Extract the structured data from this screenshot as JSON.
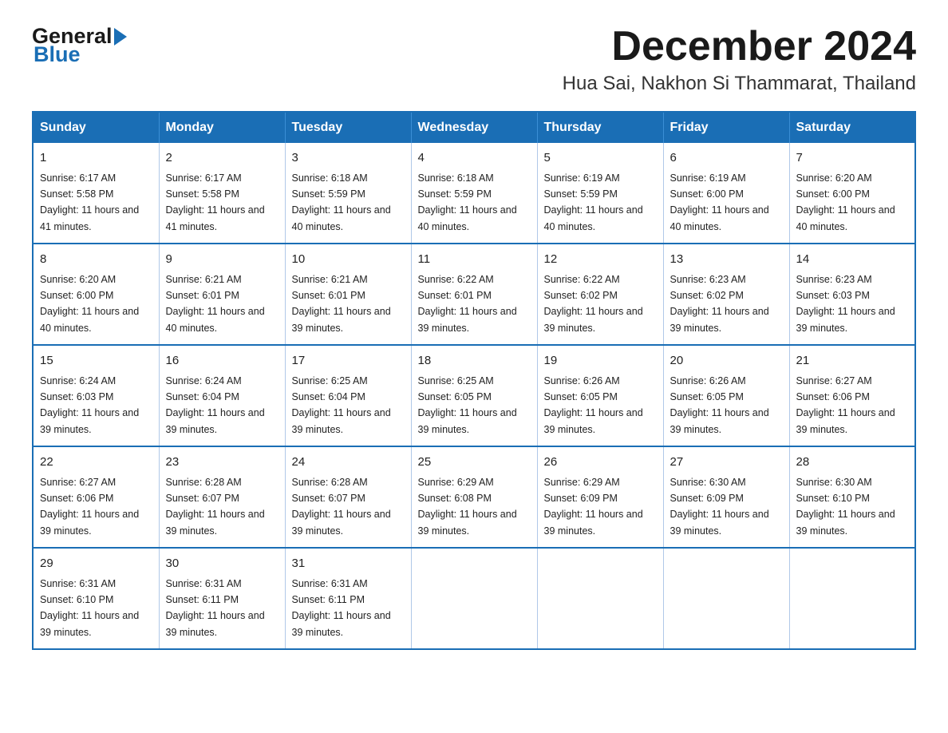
{
  "header": {
    "logo_general": "General",
    "logo_blue": "Blue",
    "title": "December 2024",
    "subtitle": "Hua Sai, Nakhon Si Thammarat, Thailand"
  },
  "calendar": {
    "days_of_week": [
      "Sunday",
      "Monday",
      "Tuesday",
      "Wednesday",
      "Thursday",
      "Friday",
      "Saturday"
    ],
    "weeks": [
      [
        {
          "day": "1",
          "sunrise": "6:17 AM",
          "sunset": "5:58 PM",
          "daylight": "11 hours and 41 minutes."
        },
        {
          "day": "2",
          "sunrise": "6:17 AM",
          "sunset": "5:58 PM",
          "daylight": "11 hours and 41 minutes."
        },
        {
          "day": "3",
          "sunrise": "6:18 AM",
          "sunset": "5:59 PM",
          "daylight": "11 hours and 40 minutes."
        },
        {
          "day": "4",
          "sunrise": "6:18 AM",
          "sunset": "5:59 PM",
          "daylight": "11 hours and 40 minutes."
        },
        {
          "day": "5",
          "sunrise": "6:19 AM",
          "sunset": "5:59 PM",
          "daylight": "11 hours and 40 minutes."
        },
        {
          "day": "6",
          "sunrise": "6:19 AM",
          "sunset": "6:00 PM",
          "daylight": "11 hours and 40 minutes."
        },
        {
          "day": "7",
          "sunrise": "6:20 AM",
          "sunset": "6:00 PM",
          "daylight": "11 hours and 40 minutes."
        }
      ],
      [
        {
          "day": "8",
          "sunrise": "6:20 AM",
          "sunset": "6:00 PM",
          "daylight": "11 hours and 40 minutes."
        },
        {
          "day": "9",
          "sunrise": "6:21 AM",
          "sunset": "6:01 PM",
          "daylight": "11 hours and 40 minutes."
        },
        {
          "day": "10",
          "sunrise": "6:21 AM",
          "sunset": "6:01 PM",
          "daylight": "11 hours and 39 minutes."
        },
        {
          "day": "11",
          "sunrise": "6:22 AM",
          "sunset": "6:01 PM",
          "daylight": "11 hours and 39 minutes."
        },
        {
          "day": "12",
          "sunrise": "6:22 AM",
          "sunset": "6:02 PM",
          "daylight": "11 hours and 39 minutes."
        },
        {
          "day": "13",
          "sunrise": "6:23 AM",
          "sunset": "6:02 PM",
          "daylight": "11 hours and 39 minutes."
        },
        {
          "day": "14",
          "sunrise": "6:23 AM",
          "sunset": "6:03 PM",
          "daylight": "11 hours and 39 minutes."
        }
      ],
      [
        {
          "day": "15",
          "sunrise": "6:24 AM",
          "sunset": "6:03 PM",
          "daylight": "11 hours and 39 minutes."
        },
        {
          "day": "16",
          "sunrise": "6:24 AM",
          "sunset": "6:04 PM",
          "daylight": "11 hours and 39 minutes."
        },
        {
          "day": "17",
          "sunrise": "6:25 AM",
          "sunset": "6:04 PM",
          "daylight": "11 hours and 39 minutes."
        },
        {
          "day": "18",
          "sunrise": "6:25 AM",
          "sunset": "6:05 PM",
          "daylight": "11 hours and 39 minutes."
        },
        {
          "day": "19",
          "sunrise": "6:26 AM",
          "sunset": "6:05 PM",
          "daylight": "11 hours and 39 minutes."
        },
        {
          "day": "20",
          "sunrise": "6:26 AM",
          "sunset": "6:05 PM",
          "daylight": "11 hours and 39 minutes."
        },
        {
          "day": "21",
          "sunrise": "6:27 AM",
          "sunset": "6:06 PM",
          "daylight": "11 hours and 39 minutes."
        }
      ],
      [
        {
          "day": "22",
          "sunrise": "6:27 AM",
          "sunset": "6:06 PM",
          "daylight": "11 hours and 39 minutes."
        },
        {
          "day": "23",
          "sunrise": "6:28 AM",
          "sunset": "6:07 PM",
          "daylight": "11 hours and 39 minutes."
        },
        {
          "day": "24",
          "sunrise": "6:28 AM",
          "sunset": "6:07 PM",
          "daylight": "11 hours and 39 minutes."
        },
        {
          "day": "25",
          "sunrise": "6:29 AM",
          "sunset": "6:08 PM",
          "daylight": "11 hours and 39 minutes."
        },
        {
          "day": "26",
          "sunrise": "6:29 AM",
          "sunset": "6:09 PM",
          "daylight": "11 hours and 39 minutes."
        },
        {
          "day": "27",
          "sunrise": "6:30 AM",
          "sunset": "6:09 PM",
          "daylight": "11 hours and 39 minutes."
        },
        {
          "day": "28",
          "sunrise": "6:30 AM",
          "sunset": "6:10 PM",
          "daylight": "11 hours and 39 minutes."
        }
      ],
      [
        {
          "day": "29",
          "sunrise": "6:31 AM",
          "sunset": "6:10 PM",
          "daylight": "11 hours and 39 minutes."
        },
        {
          "day": "30",
          "sunrise": "6:31 AM",
          "sunset": "6:11 PM",
          "daylight": "11 hours and 39 minutes."
        },
        {
          "day": "31",
          "sunrise": "6:31 AM",
          "sunset": "6:11 PM",
          "daylight": "11 hours and 39 minutes."
        },
        null,
        null,
        null,
        null
      ]
    ]
  }
}
